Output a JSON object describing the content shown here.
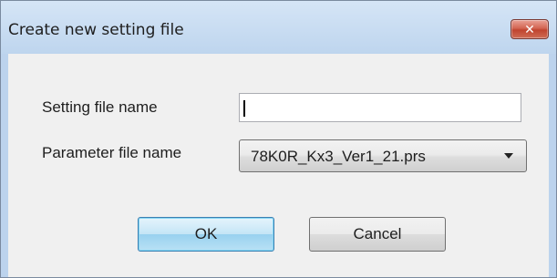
{
  "window": {
    "title": "Create new setting file",
    "close_glyph": "✕"
  },
  "form": {
    "setting_file_label": "Setting file name",
    "setting_file_value": "",
    "parameter_file_label": "Parameter file name",
    "parameter_file_selected": "78K0R_Kx3_Ver1_21.prs"
  },
  "buttons": {
    "ok": "OK",
    "cancel": "Cancel"
  },
  "icons": {
    "close": "close-icon",
    "dropdown": "chevron-down-icon"
  }
}
